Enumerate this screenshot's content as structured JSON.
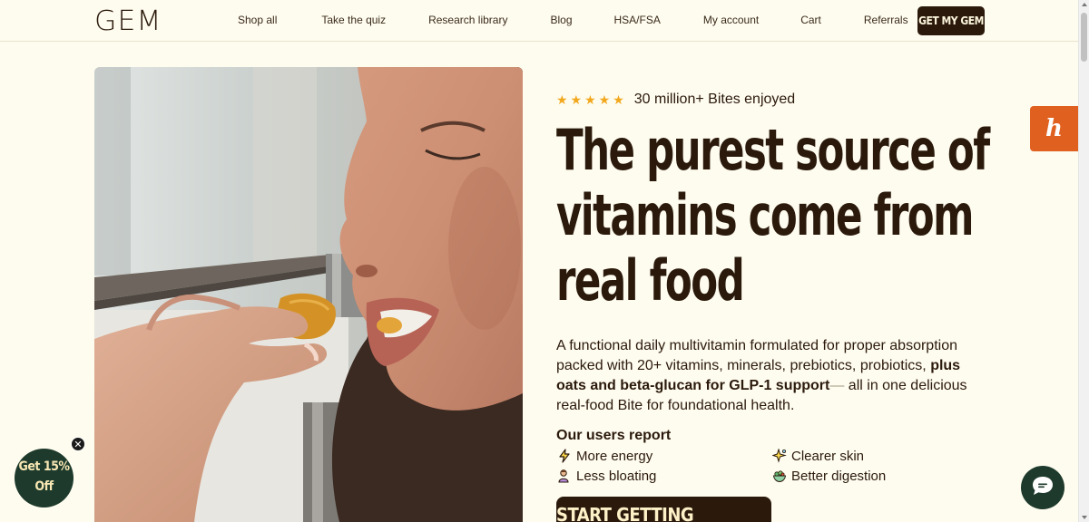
{
  "header": {
    "logo": "GEM",
    "nav": [
      {
        "label": "Shop all",
        "name": "nav-shop-all"
      },
      {
        "label": "Take the quiz",
        "name": "nav-take-the-quiz"
      },
      {
        "label": "Research library",
        "name": "nav-research-library"
      },
      {
        "label": "Blog",
        "name": "nav-blog"
      },
      {
        "label": "HSA/FSA",
        "name": "nav-hsa-fsa"
      },
      {
        "label": "My account",
        "name": "nav-my-account"
      },
      {
        "label": "Cart",
        "name": "nav-cart"
      },
      {
        "label": "Referrals",
        "name": "nav-referrals"
      }
    ],
    "cta": "GET MY GEM"
  },
  "hero": {
    "stars": "★★★★★",
    "rating_text": "30 million+ Bites enjoyed",
    "headline_line1": "The purest source of",
    "headline_line2": "vitamins come from",
    "headline_line3": "real food",
    "desc_part1": "A functional daily multivitamin formulated for proper absorption packed with 20+ vitamins, minerals, prebiotics, probiotics, ",
    "desc_bold": "plus oats and beta-glucan for GLP-1 support",
    "desc_dash": "—",
    "desc_part2": " all in one delicious real-food Bite for foundational health.",
    "users_title": "Our users report",
    "benefits": [
      {
        "label": "More energy",
        "icon": "lightning-icon"
      },
      {
        "label": "Clearer skin",
        "icon": "sparkle-icon"
      },
      {
        "label": "Less bloating",
        "icon": "person-icon"
      },
      {
        "label": "Better digestion",
        "icon": "salad-icon"
      }
    ],
    "start_button": "START GETTING RESULTS"
  },
  "widgets": {
    "honey_label": "h",
    "discount_line1": "Get 15%",
    "discount_line2": "Off",
    "discount_close": "✕"
  },
  "colors": {
    "background": "#fefcef",
    "brand_dark": "#2b1a0c",
    "star": "#f2a81d",
    "honey": "#e0601f",
    "badge_green": "#1d3a2c"
  }
}
